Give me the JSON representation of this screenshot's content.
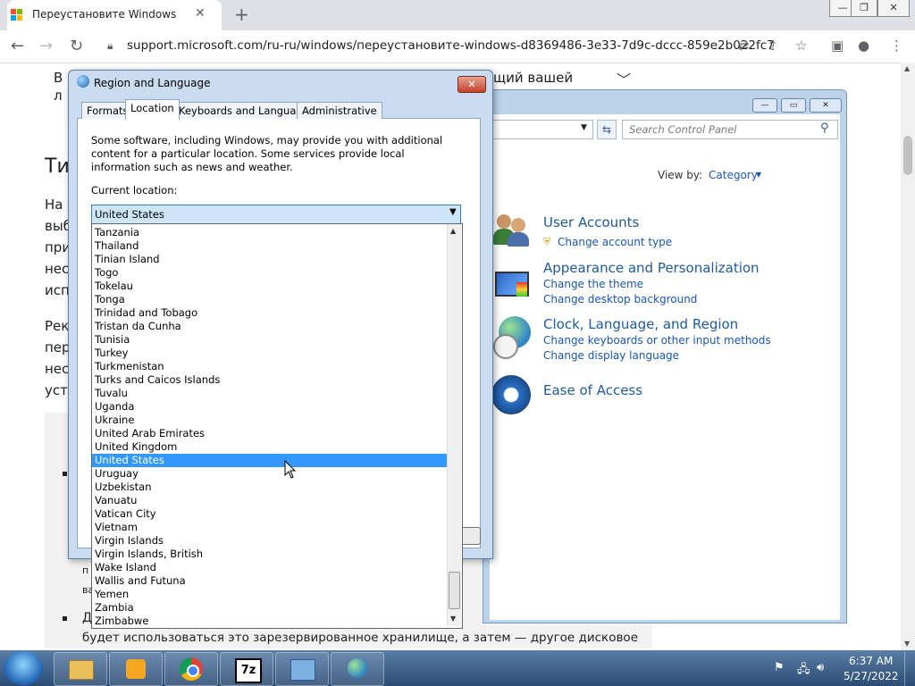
{
  "browser": {
    "tab_title": "Переустановите Windows",
    "tab_close": "✕",
    "new_tab": "+",
    "url": "support.microsoft.com/ru-ru/windows/переустановите-windows-d8369486-3e33-7d9c-dccc-859e2b022fc7",
    "window_controls": [
      "—",
      "❐",
      "✕"
    ]
  },
  "page": {
    "line1_frag_a": "В",
    "line1_frag_b": "щий вашей",
    "line2_frag": "л",
    "heading_frag": "Ти",
    "para1": [
      "На",
      "выб",
      "при",
      "нес",
      "исп"
    ],
    "para2": [
      "Рек",
      "пер",
      "нес",
      "уста"
    ],
    "bottom_frag1": "п",
    "bottom_frag2": "ва",
    "bullet2_frag": "Д",
    "last_line": "будет использоваться это зарезервированное хранилище, а затем — другое дисковое"
  },
  "control_panel": {
    "search_placeholder": "Search Control Panel",
    "view_by_label": "View by:",
    "view_by_value": "Category",
    "categories": [
      {
        "title": "User Accounts",
        "links": [
          "Change account type"
        ]
      },
      {
        "title": "Appearance and Personalization",
        "links": [
          "Change the theme",
          "Change desktop background"
        ]
      },
      {
        "title": "Clock, Language, and Region",
        "links": [
          "Change keyboards or other input methods",
          "Change display language"
        ]
      },
      {
        "title": "Ease of Access",
        "links": []
      }
    ]
  },
  "dialog": {
    "title": "Region and Language",
    "close": "✕",
    "tabs": [
      "Formats",
      "Location",
      "Keyboards and Languages",
      "Administrative"
    ],
    "active_tab": "Location",
    "description": "Some software, including Windows, may provide you with additional content for a particular location. Some services provide local information such as news and weather.",
    "current_location_label": "Current location:",
    "current_location_value": "United States",
    "list_items": [
      "Tanzania",
      "Thailand",
      "Tinian Island",
      "Togo",
      "Tokelau",
      "Tonga",
      "Trinidad and Tobago",
      "Tristan da Cunha",
      "Tunisia",
      "Turkey",
      "Turkmenistan",
      "Turks and Caicos Islands",
      "Tuvalu",
      "Uganda",
      "Ukraine",
      "United Arab Emirates",
      "United Kingdom",
      "United States",
      "Uruguay",
      "Uzbekistan",
      "Vanuatu",
      "Vatican City",
      "Vietnam",
      "Virgin Islands",
      "Virgin Islands, British",
      "Wake Island",
      "Wallis and Futuna",
      "Yemen",
      "Zambia",
      "Zimbabwe"
    ],
    "selected_item": "United States"
  },
  "taskbar": {
    "time": "6:37 AM",
    "date": "5/27/2022"
  }
}
